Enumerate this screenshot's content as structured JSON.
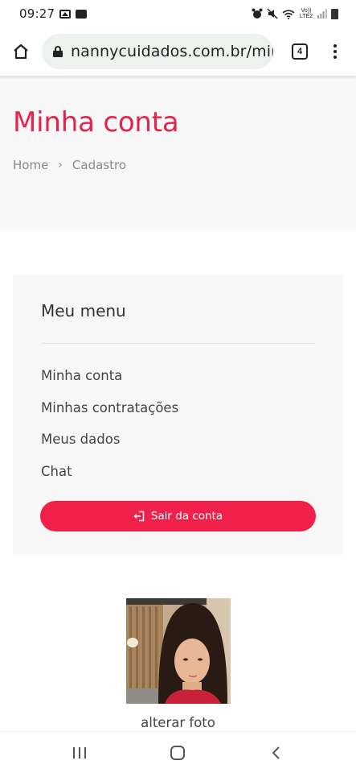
{
  "status_bar": {
    "time": "09:27",
    "network_label": "Vo)) LTE2"
  },
  "browser": {
    "url": "nannycuidados.com.br/minh",
    "tab_count": "4"
  },
  "header": {
    "title": "Minha conta",
    "breadcrumb": [
      "Home",
      "Cadastro"
    ]
  },
  "menu": {
    "title": "Meu menu",
    "items": [
      {
        "label": "Minha conta"
      },
      {
        "label": "Minhas contratações"
      },
      {
        "label": "Meus dados"
      },
      {
        "label": "Chat"
      }
    ],
    "logout_label": "Sair da conta"
  },
  "profile": {
    "change_photo_label": "alterar foto"
  },
  "colors": {
    "accent": "#e3244d",
    "button": "#f1204b",
    "panel": "#f7f7f7"
  },
  "icons": [
    "image-icon",
    "media-icon",
    "alarm-icon",
    "mute-icon",
    "wifi-icon",
    "signal-icon",
    "battery-icon",
    "home-icon",
    "lock-icon",
    "tabs-icon",
    "more-vert-icon",
    "logout-icon",
    "recents-icon",
    "home-nav-icon",
    "back-icon"
  ]
}
